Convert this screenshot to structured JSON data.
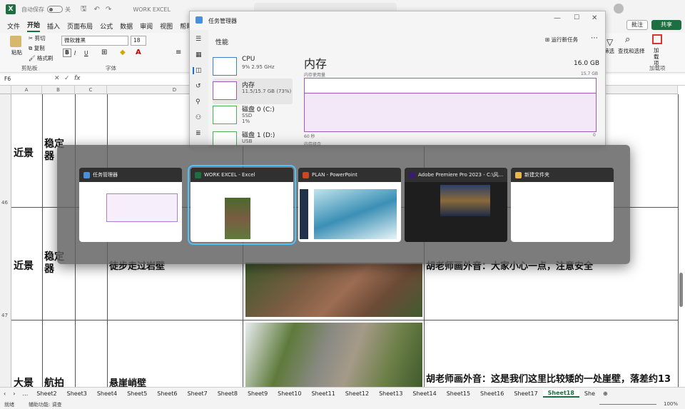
{
  "excel": {
    "autosave_label": "自动保存",
    "autosave_state": "关",
    "title": "WORK EXCEL",
    "menu_tabs": [
      "文件",
      "开始",
      "插入",
      "页面布局",
      "公式",
      "数据",
      "审阅",
      "视图",
      "帮助"
    ],
    "active_tab": "开始",
    "clipboard": {
      "paste": "粘贴",
      "cut": "剪切",
      "copy": "复制",
      "format_painter": "格式刷",
      "group": "剪贴板"
    },
    "font": {
      "name": "微软雅黑",
      "size": "18",
      "group": "字体"
    },
    "right_tools": {
      "filter": "筛选",
      "find": "查找和选择",
      "addins": "加载项",
      "addins_btn": "加\n载项"
    },
    "comment_button": "批注",
    "share_button": "共享",
    "name_box": "F6",
    "fx": "fx",
    "columns": [
      "A",
      "B",
      "C",
      "D"
    ],
    "rows": [
      "46",
      "47"
    ],
    "cells": {
      "r1_a": "近景",
      "r1_b": "稳定器",
      "r2_a": "近景",
      "r2_b": "稳定器",
      "r2_d": "徒步走过岩壁",
      "r2_f": "胡老师画外音：大家小心一点，注意安全",
      "r3_a": "大景",
      "r3_b": "航拍",
      "r3_d": "悬崖峭壁",
      "r3_f": "胡老师画外音：这是我们这里比较矮的一处崖壁，落差约13"
    },
    "sheets": [
      "Sheet2",
      "Sheet3",
      "Sheet4",
      "Sheet5",
      "Sheet6",
      "Sheet7",
      "Sheet8",
      "Sheet9",
      "Sheet10",
      "Sheet11",
      "Sheet12",
      "Sheet13",
      "Sheet14",
      "Sheet15",
      "Sheet16",
      "Sheet17",
      "Sheet18",
      "She"
    ],
    "active_sheet": "Sheet18",
    "status_ready": "就绪",
    "accessibility": "辅助功能: 调查",
    "zoom": "100%"
  },
  "task_manager": {
    "title": "任务管理器",
    "section": "性能",
    "run_task": "运行新任务",
    "items": [
      {
        "name": "CPU",
        "l1": "9% 2.95 GHz",
        "l2": ""
      },
      {
        "name": "内存",
        "l1": "11.5/15.7 GB (73%)",
        "l2": ""
      },
      {
        "name": "磁盘 0 (C:)",
        "l1": "SSD",
        "l2": "1%"
      },
      {
        "name": "磁盘 1 (D:)",
        "l1": "USB",
        "l2": ""
      }
    ],
    "heading": "内存",
    "total": "16.0 GB",
    "usage_label": "内存使用量",
    "usage_max": "15.7 GB",
    "axis_left": "60 秒",
    "axis_right": "0",
    "composition": "内存组合",
    "usage_percent": 73
  },
  "switcher": {
    "windows": [
      {
        "title": "任务管理器",
        "color": "#4a90d9"
      },
      {
        "title": "WORK EXCEL  -  Excel",
        "color": "#1d6f42"
      },
      {
        "title": "PLAN  -  PowerPoint",
        "color": "#d04423"
      },
      {
        "title": "Adobe Premiere Pro 2023 - C:\\风...",
        "color": "#3b1b6b"
      },
      {
        "title": "新建文件夹",
        "color": "#e8b84a"
      }
    ],
    "selected_index": 1
  }
}
